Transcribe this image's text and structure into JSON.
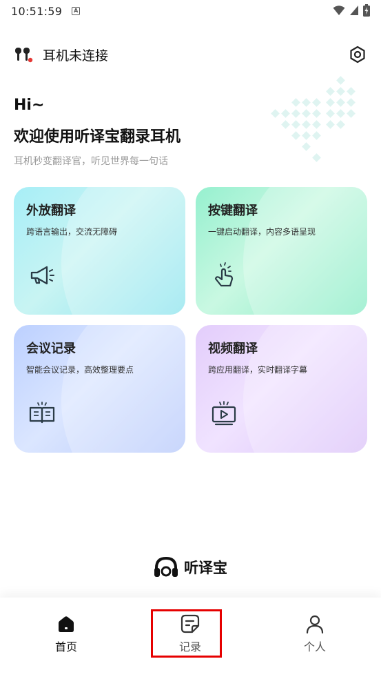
{
  "status_bar": {
    "time": "10:51:59",
    "notification_icon": "A"
  },
  "header": {
    "title": "耳机未连接",
    "earbuds_icon": "earbuds-icon",
    "settings_icon": "hexagon-settings-icon"
  },
  "greeting": {
    "hi": "Hi~",
    "welcome": "欢迎使用听译宝翻录耳机",
    "subtitle": "耳机秒变翻译官，听见世界每一句话"
  },
  "cards": [
    {
      "title": "外放翻译",
      "desc": "跨语言输出，交流无障碍",
      "icon": "megaphone-icon",
      "color": "#a7eef7"
    },
    {
      "title": "按键翻译",
      "desc": "一键启动翻译，内容多语呈现",
      "icon": "tap-hand-icon",
      "color": "#96f0cf"
    },
    {
      "title": "会议记录",
      "desc": "智能会议记录，高效整理要点",
      "icon": "open-book-icon",
      "color": "#bcd0ff"
    },
    {
      "title": "视频翻译",
      "desc": "跨应用翻译，实时翻译字幕",
      "icon": "video-play-icon",
      "color": "#e3cdfb"
    }
  ],
  "brand": {
    "name": "听译宝",
    "logo": "headphones-logo"
  },
  "nav": [
    {
      "label": "首页",
      "icon": "home-icon",
      "active": true
    },
    {
      "label": "记录",
      "icon": "note-icon",
      "active": false
    },
    {
      "label": "个人",
      "icon": "person-icon",
      "active": false
    }
  ],
  "highlight_color": "#e60000"
}
